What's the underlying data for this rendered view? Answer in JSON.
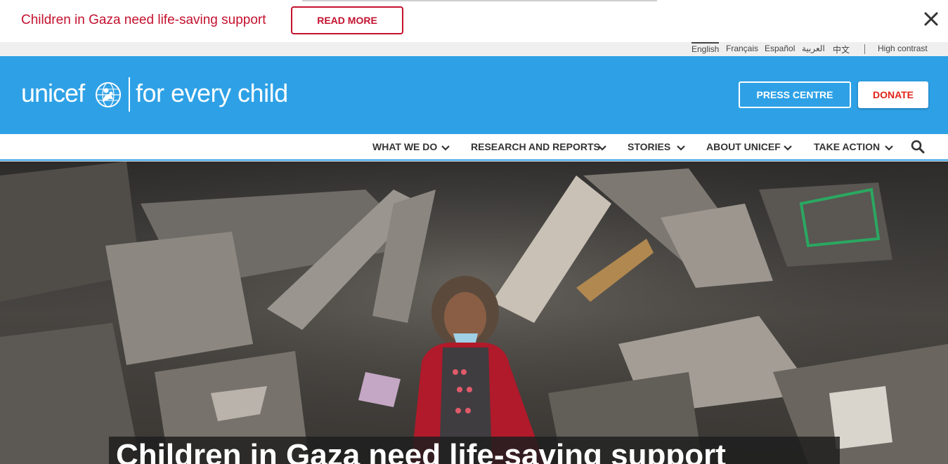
{
  "alert": {
    "message": "Children in Gaza need life-saving support",
    "button_label": "READ MORE",
    "close_icon": "close-icon"
  },
  "utility": {
    "languages": [
      {
        "label": "English",
        "active": true
      },
      {
        "label": "Français",
        "active": false
      },
      {
        "label": "Español",
        "active": false
      },
      {
        "label": "العربية",
        "active": false
      },
      {
        "label": "中文",
        "active": false
      }
    ],
    "high_contrast": "High contrast"
  },
  "header": {
    "logo_word": "unicef",
    "tagline": "for every child",
    "press_label": "PRESS CENTRE",
    "donate_label": "DONATE"
  },
  "nav": {
    "items": [
      {
        "label": "WHAT WE DO"
      },
      {
        "label": "RESEARCH AND REPORTS"
      },
      {
        "label": "STORIES"
      },
      {
        "label": "ABOUT UNICEF"
      },
      {
        "label": "TAKE ACTION"
      }
    ],
    "search_icon": "search-icon"
  },
  "hero": {
    "title": "Children in Gaza need life-saving support"
  },
  "colors": {
    "brand_blue": "#2ea1e6",
    "alert_red": "#c4122f",
    "donate_red": "#e2231a"
  }
}
